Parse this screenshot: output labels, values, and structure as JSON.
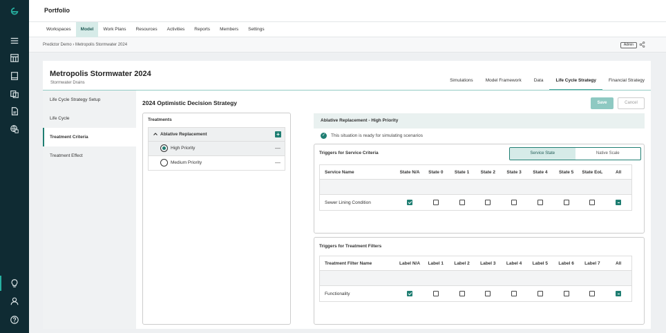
{
  "app": {
    "title": "Portfolio"
  },
  "nav": {
    "items": [
      {
        "label": "Workspaces",
        "active": false
      },
      {
        "label": "Model",
        "active": true
      },
      {
        "label": "Work Plans",
        "active": false
      },
      {
        "label": "Resources",
        "active": false
      },
      {
        "label": "Activities",
        "active": false
      },
      {
        "label": "Reports",
        "active": false
      },
      {
        "label": "Members",
        "active": false
      },
      {
        "label": "Settings",
        "active": false
      }
    ]
  },
  "breadcrumb": {
    "text": "Predictor Demo › Metropolis Stormwater 2024",
    "badge": "Admin"
  },
  "model": {
    "title": "Metropolis Stormwater 2024",
    "subtitle": "Stormwater Drains",
    "tabs": [
      {
        "label": "Simulations",
        "active": false
      },
      {
        "label": "Model Framework",
        "active": false
      },
      {
        "label": "Data",
        "active": false
      },
      {
        "label": "Life Cycle Strategy",
        "active": true
      },
      {
        "label": "Financial Strategy",
        "active": false
      }
    ]
  },
  "leftnav": {
    "items": [
      {
        "label": "Life Cycle Strategy Setup",
        "active": false
      },
      {
        "label": "Life Cycle",
        "active": false
      },
      {
        "label": "Treatment Criteria",
        "active": true
      },
      {
        "label": "Treatment Effect",
        "active": false
      }
    ]
  },
  "strategy": {
    "title": "2024 Optimistic Decision Strategy",
    "save_label": "Save",
    "cancel_label": "Cancel"
  },
  "treatments": {
    "heading": "Treatments",
    "group": "Ablative Replacement",
    "options": [
      {
        "label": "High Priority",
        "selected": true
      },
      {
        "label": "Medium Priority",
        "selected": false
      }
    ]
  },
  "detail": {
    "header": "Ablative Replacement - High Priority",
    "ready_text": "This situation is ready for simulating scenarios"
  },
  "service_triggers": {
    "heading": "Triggers for Service Criteria",
    "toggle": [
      "Service State",
      "Native Scale"
    ],
    "name_header": "Service Name",
    "columns": [
      "State N/A",
      "State 0",
      "State 1",
      "State 2",
      "State 3",
      "State 4",
      "State 5",
      "State EoL",
      "All"
    ],
    "rows": [
      {
        "name": "Sewer Lining Condition",
        "checks": [
          "on",
          "off",
          "off",
          "off",
          "off",
          "off",
          "off",
          "off",
          "ind"
        ]
      }
    ]
  },
  "filter_triggers": {
    "heading": "Triggers for Treatment Filters",
    "name_header": "Treatment Filter Name",
    "columns": [
      "Label N/A",
      "Label 1",
      "Label 2",
      "Label 3",
      "Label 4",
      "Label 5",
      "Label 6",
      "Label 7",
      "All"
    ],
    "rows": [
      {
        "name": "Functionality",
        "checks": [
          "on",
          "off",
          "off",
          "off",
          "off",
          "off",
          "off",
          "off",
          "ind"
        ]
      }
    ]
  },
  "icons": {
    "rail_top": [
      "logo-icon",
      "menu-icon",
      "dashboard-icon",
      "book-icon",
      "copy-icon",
      "document-icon",
      "globe-icon"
    ],
    "rail_bottom": [
      "lightbulb-icon",
      "user-icon",
      "help-icon"
    ],
    "accent": "#1f7e72"
  }
}
